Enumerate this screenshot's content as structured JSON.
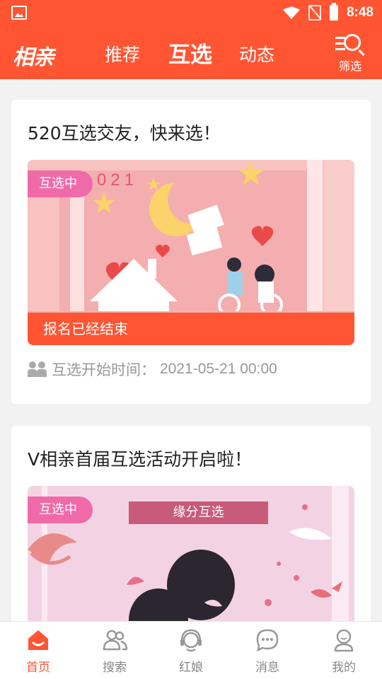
{
  "status": {
    "time": "8:48"
  },
  "header": {
    "logo": "相亲",
    "tabs": [
      "推荐",
      "互选",
      "动态"
    ],
    "active_tab": 1,
    "filter_label": "筛选"
  },
  "cards": [
    {
      "title": "520互选交友，快来选！",
      "badge": "互选中",
      "status_text": "报名已经结束",
      "banner_year": "021",
      "time_label": "互选开始时间：",
      "time_value": "2021-05-21 00:00"
    },
    {
      "title": "V相亲首届互选活动开启啦！",
      "badge": "互选中",
      "banner_text": "缘分互选"
    }
  ],
  "bottom_nav": [
    {
      "label": "首页",
      "icon": "home-icon",
      "active": true
    },
    {
      "label": "搜索",
      "icon": "people-icon",
      "active": false
    },
    {
      "label": "红娘",
      "icon": "headset-icon",
      "active": false
    },
    {
      "label": "消息",
      "icon": "message-icon",
      "active": false
    },
    {
      "label": "我的",
      "icon": "user-icon",
      "active": false
    }
  ],
  "colors": {
    "primary": "#ff5533",
    "badge_pink": "#f06aaa",
    "text_gray": "#999999"
  }
}
